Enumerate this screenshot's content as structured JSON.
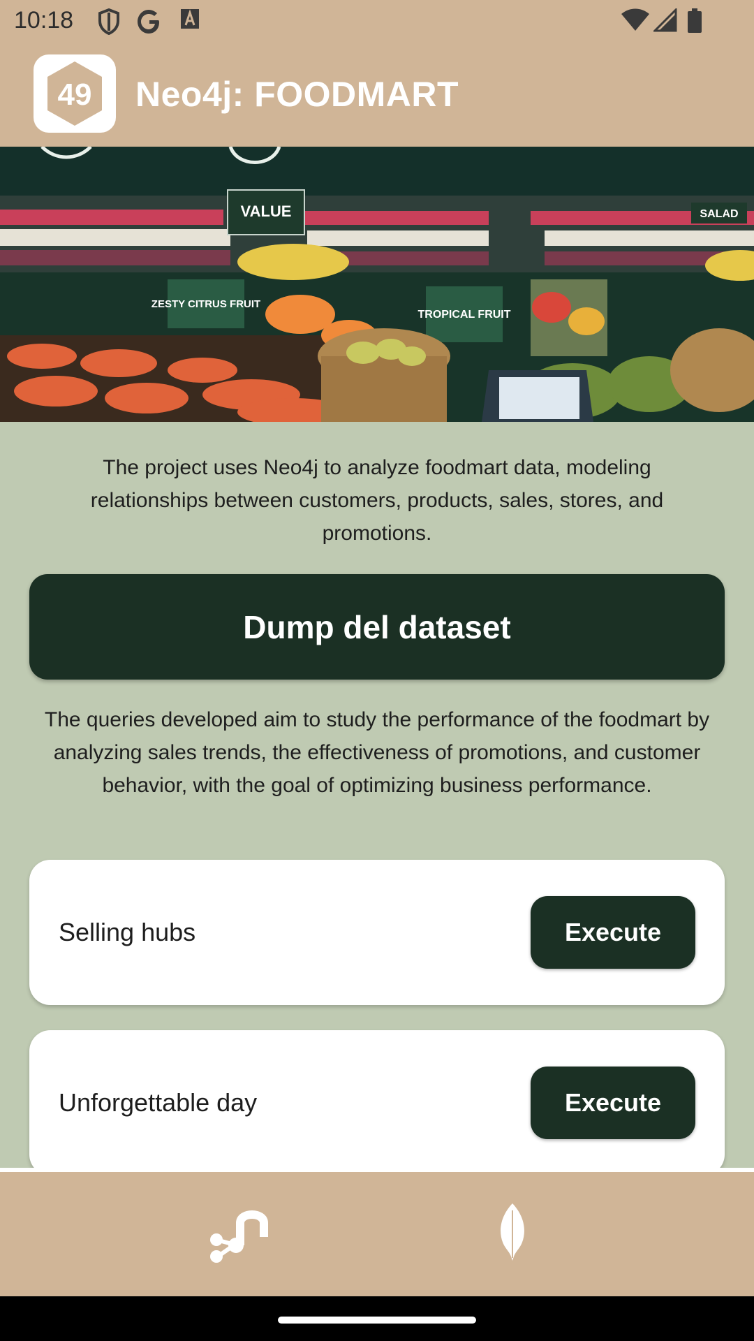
{
  "status_bar": {
    "time": "10:18",
    "left_icons": [
      "shield-icon",
      "google-g-icon",
      "text-a-icon"
    ],
    "right_icons": [
      "wifi-icon",
      "signal-icon",
      "battery-icon"
    ]
  },
  "appbar": {
    "logo_text": "49",
    "title": "Neo4j: FOODMART"
  },
  "hero": {
    "sign_zesty": "ZESTY CITRUS FRUIT",
    "sign_tropical": "TROPICAL FRUIT",
    "sign_value": "VALUE",
    "sign_salad": "SALAD"
  },
  "main": {
    "intro": "The project uses Neo4j to analyze foodmart data, modeling relationships between customers, products, sales, stores, and promotions.",
    "dump_label": "Dump del dataset",
    "query_intro": "The queries developed aim to study the performance of the foodmart by analyzing sales trends, the effectiveness of promotions, and customer behavior, with the goal of optimizing business performance.",
    "queries": [
      {
        "label": "Selling hubs",
        "button": "Execute"
      },
      {
        "label": "Unforgettable day",
        "button": "Execute"
      }
    ]
  },
  "bottom_nav": {
    "items": [
      "neo4j-graph-icon",
      "mongodb-leaf-icon"
    ]
  },
  "colors": {
    "header": "#d0b597",
    "background": "#bfcab2",
    "button": "#1b3024",
    "card": "#ffffff"
  }
}
